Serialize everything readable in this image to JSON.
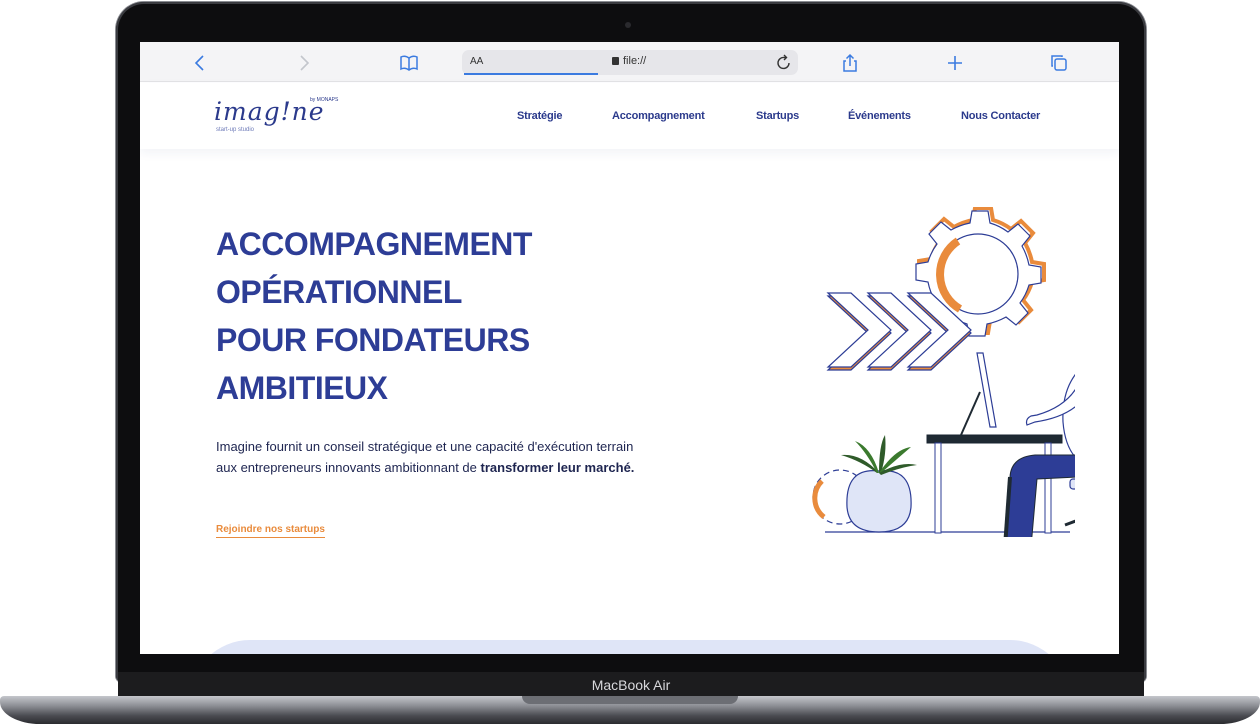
{
  "device": {
    "label": "MacBook Air"
  },
  "browser": {
    "reader_label": "AA",
    "url": "file://"
  },
  "site": {
    "logo": {
      "word": "imag!ne",
      "by": "by MONAPS",
      "sub": "start-up studio"
    },
    "nav": [
      "Stratégie",
      "Accompagnement",
      "Startups",
      "Événements",
      "Nous Contacter"
    ]
  },
  "hero": {
    "title_lines": [
      "ACCOMPAGNEMENT",
      "OPÉRATIONNEL",
      "POUR FONDATEURS",
      "AMBITIEUX"
    ],
    "description_start": "Imagine fournit un conseil stratégique et une capacité d'exécution terrain aux entrepreneurs innovants ambitionnant de ",
    "description_bold": "transformer leur marché.",
    "cta": "Rejoindre nos startups"
  },
  "colors": {
    "brand_blue": "#2d3d96",
    "accent_orange": "#e98b3c",
    "light_blue": "#dfe5f7"
  }
}
